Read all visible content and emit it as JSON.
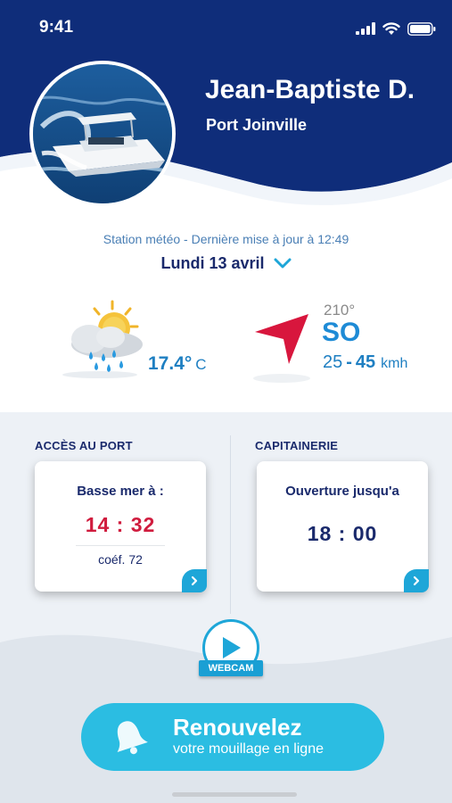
{
  "status_bar": {
    "time": "9:41"
  },
  "profile": {
    "name": "Jean-Baptiste D.",
    "port": "Port Joinville",
    "avatar_icon": "boat-photo"
  },
  "weather": {
    "station_text": "Station météo - Dernière mise à jour à 12:49",
    "date": "Lundi 13 avril",
    "temperature": "17.4°",
    "temperature_unit": "C",
    "icon": "sun-cloud-rain-icon",
    "wind": {
      "degrees": "210°",
      "direction": "SO",
      "speed_min": "25",
      "separator": "-",
      "speed_max": "45",
      "unit": "kmh"
    }
  },
  "sections": {
    "port_access": {
      "title": "ACCÈS AU PORT",
      "card_label": "Basse mer à :",
      "time": "14 : 32",
      "coef": "coéf. 72"
    },
    "harbour_office": {
      "title": "CAPITAINERIE",
      "card_label": "Ouverture jusqu'a",
      "time": "18 : 00"
    }
  },
  "webcam": {
    "label": "WEBCAM"
  },
  "cta": {
    "title": "Renouvelez",
    "subtitle": "votre mouillage en ligne"
  },
  "colors": {
    "navy": "#1a2a6c",
    "header": "#0f2d7a",
    "accent": "#1ea6d8",
    "red": "#d01c3e"
  }
}
